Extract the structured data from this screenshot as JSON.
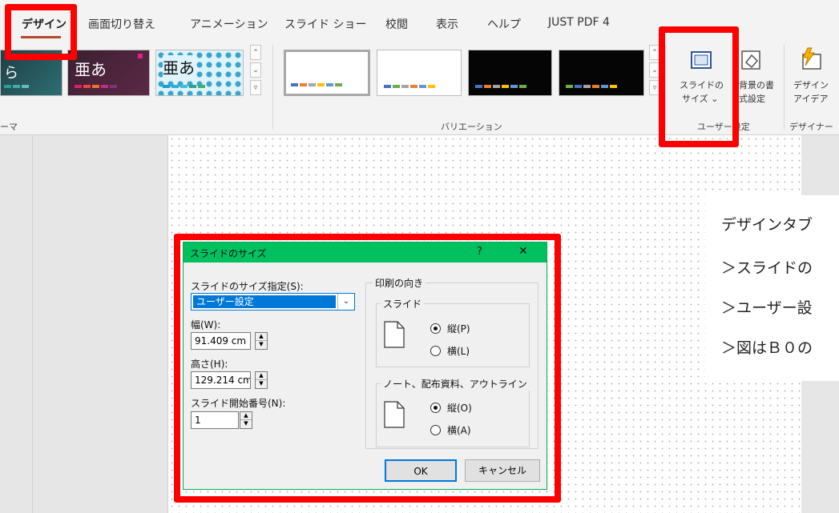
{
  "tabs": [
    "デザイン",
    "画面切り替え",
    "アニメーション",
    "スライド ショー",
    "校閲",
    "表示",
    "ヘルプ",
    "JUST PDF 4"
  ],
  "ribbon": {
    "theme_sample_text": "亜あ",
    "theme_partial_label": "ーマ",
    "variations_label": "バリエーション",
    "slide_size_line1": "スライドの",
    "slide_size_line2": "サイズ ⌄",
    "bg_format_line1": "背景の書",
    "bg_format_line2": "式設定",
    "design_ideas_line1": "デザイン",
    "design_ideas_line2": "アイデア",
    "customize_label": "ユーザー設定",
    "designer_label": "デザイナー"
  },
  "note": {
    "lines": [
      "デザインタブ",
      "＞スライドの",
      "＞ユーザー設",
      "＞図はＢ０の"
    ]
  },
  "dialog": {
    "title": "スライドのサイズ",
    "help": "?",
    "close": "✕",
    "size_for_label": "スライドのサイズ指定(S):",
    "size_for_value": "ユーザー設定",
    "width_label": "幅(W):",
    "width_value": "91.409 cm",
    "height_label": "高さ(H):",
    "height_value": "129.214 cm",
    "number_from_label": "スライド開始番号(N):",
    "number_from_value": "1",
    "orientation_label": "印刷の向き",
    "slides_label": "スライド",
    "slides_portrait": "縦(P)",
    "slides_landscape": "横(L)",
    "notes_label": "ノート、配布資料、アウトライン",
    "notes_portrait": "縦(O)",
    "notes_landscape": "横(A)",
    "ok": "OK",
    "cancel": "キャンセル"
  },
  "colors": {
    "highlight": "#ff0000",
    "dialog_title_bg": "#00c060",
    "selection": "#0078d7"
  }
}
